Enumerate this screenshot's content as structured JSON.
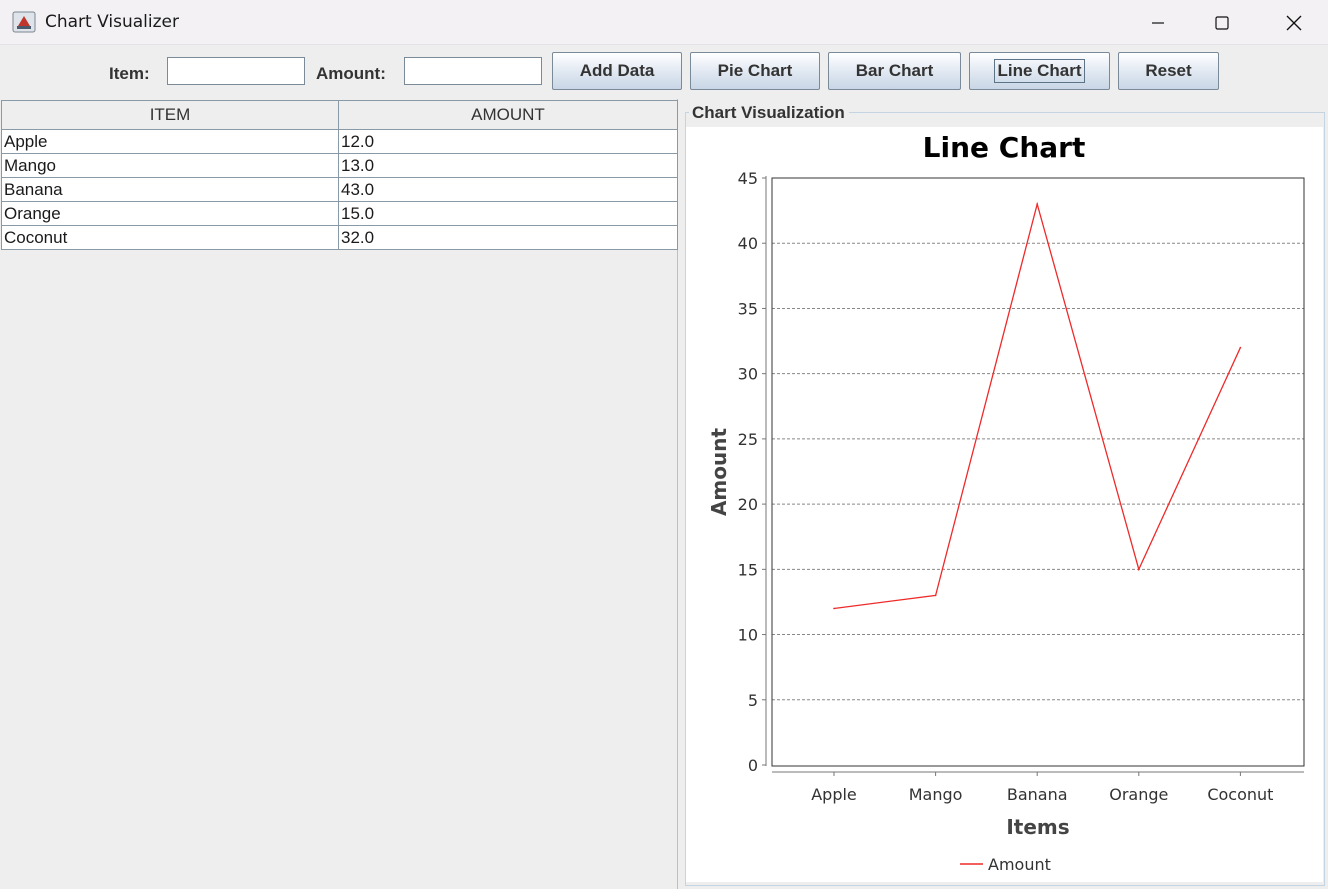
{
  "window": {
    "title": "Chart Visualizer",
    "icon": "java-cup-icon"
  },
  "toolbar": {
    "item_label": "Item:",
    "item_value": "",
    "amount_label": "Amount:",
    "amount_value": "",
    "add_label": "Add Data",
    "pie_label": "Pie Chart",
    "bar_label": "Bar Chart",
    "line_label": "Line Chart",
    "reset_label": "Reset"
  },
  "table": {
    "headers": [
      "ITEM",
      "AMOUNT"
    ],
    "rows": [
      [
        "Apple",
        "12.0"
      ],
      [
        "Mango",
        "13.0"
      ],
      [
        "Banana",
        "43.0"
      ],
      [
        "Orange",
        "15.0"
      ],
      [
        "Coconut",
        "32.0"
      ]
    ]
  },
  "panel": {
    "title": "Chart Visualization"
  },
  "colors": {
    "series": "#ee2a2a",
    "button_top": "#ffffff",
    "button_bottom": "#c9d6e6"
  },
  "chart_data": {
    "type": "line",
    "title": "Line Chart",
    "xlabel": "Items",
    "ylabel": "Amount",
    "categories": [
      "Apple",
      "Mango",
      "Banana",
      "Orange",
      "Coconut"
    ],
    "series": [
      {
        "name": "Amount",
        "values": [
          12,
          13,
          43,
          15,
          32
        ],
        "color": "#ee2a2a"
      }
    ],
    "ylim": [
      0,
      45
    ],
    "yticks": [
      0,
      5,
      10,
      15,
      20,
      25,
      30,
      35,
      40,
      45
    ],
    "grid": "horizontal-dashed",
    "legend": "bottom"
  }
}
